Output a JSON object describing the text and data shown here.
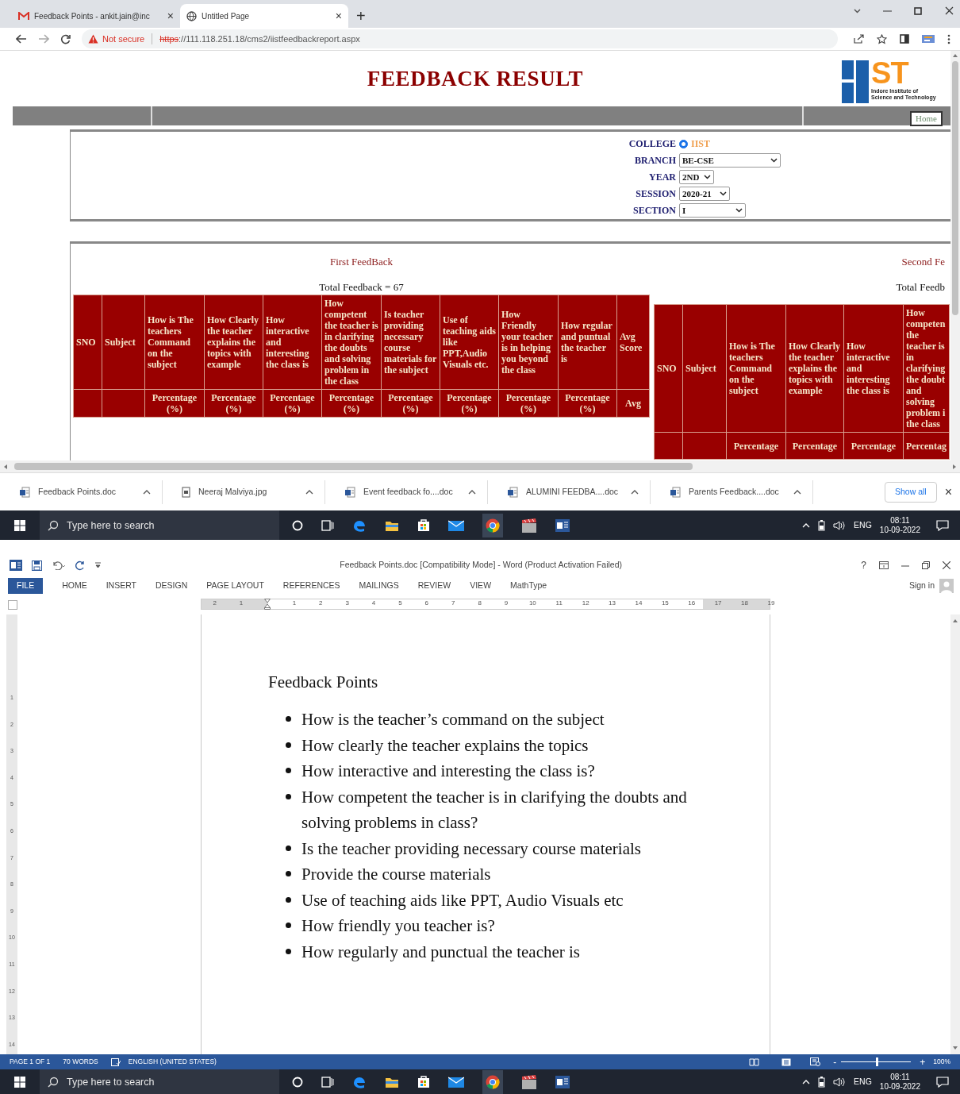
{
  "browser": {
    "tabs": [
      {
        "title": "Feedback Points - ankit.jain@inc",
        "selected": false,
        "close": "×"
      },
      {
        "title": "Untitled Page",
        "selected": true,
        "close": "×"
      }
    ],
    "new_tab": "+",
    "security": "Not secure",
    "url": {
      "scheme": "https",
      "rest": "://111.118.251.18/cms2/iistfeedbackreport.aspx"
    },
    "page": {
      "title": "FEEDBACK RESULT",
      "logo": {
        "letters": "ST",
        "caption": "Indore Institute of Science and Technology"
      },
      "home_link": "Home",
      "form": [
        {
          "label": "COLLEGE",
          "kind": "radio",
          "option": "IIST",
          "checked": true
        },
        {
          "label": "BRANCH",
          "kind": "select",
          "value": "BE-CSE"
        },
        {
          "label": "YEAR",
          "kind": "select",
          "value": "2ND"
        },
        {
          "label": "SESSION",
          "kind": "select",
          "value": "2020-21"
        },
        {
          "label": "SECTION",
          "kind": "select",
          "value": "I"
        }
      ],
      "panels": [
        {
          "heading": "First FeedBack",
          "total": "Total Feedback = 67",
          "columns": [
            {
              "header": "SNO"
            },
            {
              "header": "Subject"
            },
            {
              "header": "How is The teachers Command on the subject",
              "subheader": "Percentage (%)"
            },
            {
              "header": "How Clearly the teacher explains the topics with example",
              "subheader": "Percentage (%)"
            },
            {
              "header": "How interactive and interesting the class is",
              "subheader": "Percentage (%)"
            },
            {
              "header": "How competent the teacher is in clarifying the doubts and solving problem in the class",
              "subheader": "Percentage (%)"
            },
            {
              "header": "Is teacher providing necessary course materials for the subject",
              "subheader": "Percentage (%)"
            },
            {
              "header": "Use of teaching aids like PPT,Audio Visuals etc.",
              "subheader": "Percentage (%)"
            },
            {
              "header": "How Friendly your teacher is in helping you beyond the class",
              "subheader": "Percentage (%)"
            },
            {
              "header": "How regular and puntual the teacher is",
              "subheader": "Percentage (%)"
            },
            {
              "header": "Avg Score",
              "subheader": "Avg"
            }
          ]
        },
        {
          "heading": "Second Fe",
          "total": "Total Feedb",
          "columns": [
            {
              "header": "SNO"
            },
            {
              "header": "Subject"
            },
            {
              "header": "How is The teachers Command on the subject",
              "subheader": "Percentage"
            },
            {
              "header": "How Clearly the teacher explains the topics with example",
              "subheader": "Percentage"
            },
            {
              "header": "How interactive and interesting the class is",
              "subheader": "Percentage"
            },
            {
              "header": "How competen the teacher is in clarifying the doubt and solving problem i the class",
              "subheader": "Percentag"
            }
          ]
        }
      ]
    },
    "downloads": [
      {
        "name": "Feedback Points.doc",
        "kind": "doc"
      },
      {
        "name": "Neeraj Malviya.jpg",
        "kind": "image"
      },
      {
        "name": "Event feedback fo....doc",
        "kind": "doc"
      },
      {
        "name": "ALUMINI FEEDBA....doc",
        "kind": "doc"
      },
      {
        "name": "Parents Feedback....doc",
        "kind": "doc"
      }
    ],
    "show_all": "Show all",
    "close_downloads": "×"
  },
  "taskbar_1": {
    "search_placeholder": "Type here to search",
    "language": "ENG",
    "time": "08:11",
    "date": "10-09-2022"
  },
  "word": {
    "title": "Feedback Points.doc [Compatibility Mode] - Word (Product Activation Failed)",
    "help": "?",
    "file_tab": "FILE",
    "ribbon_tabs": [
      "HOME",
      "INSERT",
      "DESIGN",
      "PAGE LAYOUT",
      "REFERENCES",
      "MAILINGS",
      "REVIEW",
      "VIEW",
      "MathType"
    ],
    "sign_in": "Sign in",
    "ruler_labels": [
      "2",
      "1",
      "1",
      "2",
      "3",
      "4",
      "5",
      "6",
      "7",
      "8",
      "9",
      "10",
      "11",
      "12",
      "13",
      "14",
      "15",
      "16",
      "17",
      "18",
      "19"
    ],
    "vertical_ruler_labels": [
      "1",
      "2",
      "3",
      "4",
      "5",
      "6",
      "7",
      "8",
      "9",
      "10",
      "11",
      "12",
      "13",
      "14"
    ],
    "document": {
      "heading": "Feedback Points",
      "bullets": [
        "How is the teacher’s command on the subject",
        "How clearly the teacher explains the topics",
        "How interactive and interesting the class is?",
        "How competent the teacher is in clarifying the doubts and solving problems in class?",
        "Is the teacher providing necessary course materials",
        "Provide the course materials",
        "Use of teaching aids like PPT, Audio Visuals etc",
        "How friendly you teacher is?",
        "How regularly and punctual the teacher is"
      ]
    },
    "status_bar": {
      "page": "PAGE 1 OF 1",
      "words": "70 WORDS",
      "language": "ENGLISH (UNITED STATES)",
      "zoom_out": "-",
      "zoom_in": "+",
      "zoom": "100%",
      "zoom_slider": {
        "level": 0.5
      }
    }
  },
  "taskbar_2": {
    "search_placeholder": "Type here to search",
    "language": "ENG",
    "time": "08:11",
    "date": "10-09-2022"
  }
}
